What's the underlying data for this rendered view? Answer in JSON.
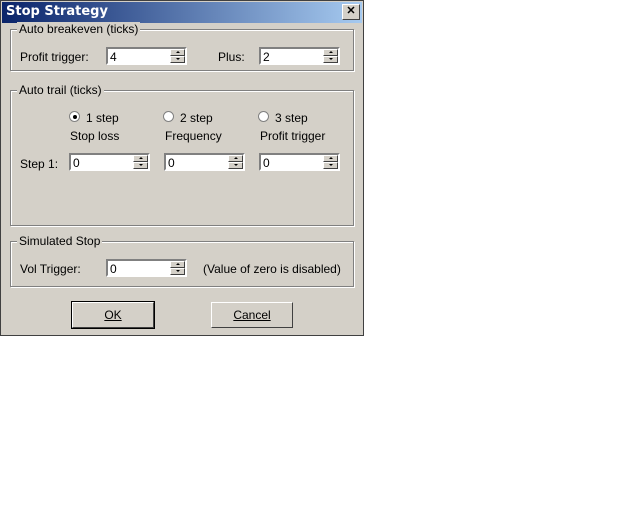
{
  "window": {
    "title": "Stop Strategy",
    "close_glyph": "✕"
  },
  "auto_breakeven": {
    "legend": "Auto breakeven (ticks)",
    "profit_trigger_label": "Profit trigger:",
    "profit_trigger_value": "4",
    "plus_label": "Plus:",
    "plus_value": "2"
  },
  "auto_trail": {
    "legend": "Auto trail (ticks)",
    "options": [
      {
        "label": "1 step",
        "selected": true
      },
      {
        "label": "2 step",
        "selected": false
      },
      {
        "label": "3 step",
        "selected": false
      }
    ],
    "columns": [
      "Stop loss",
      "Frequency",
      "Profit trigger"
    ],
    "row_label": "Step 1:",
    "row_values": [
      "0",
      "0",
      "0"
    ]
  },
  "simulated_stop": {
    "legend": "Simulated Stop",
    "vol_trigger_label": "Vol Trigger:",
    "vol_trigger_value": "0",
    "note": "(Value of zero is disabled)"
  },
  "buttons": {
    "ok_label": "OK",
    "cancel_label": "Cancel"
  }
}
